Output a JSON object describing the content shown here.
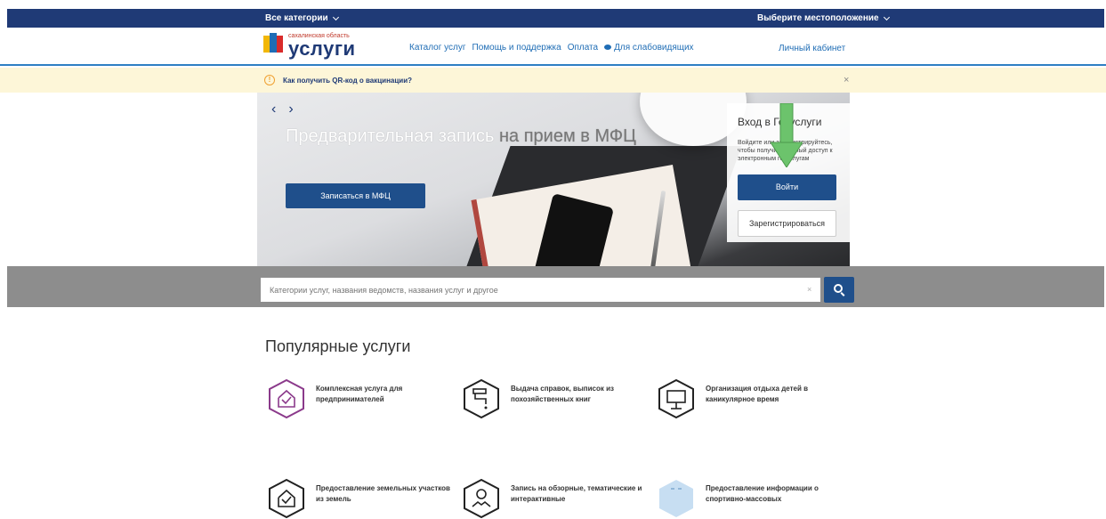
{
  "topbar": {
    "all_categories": "Все категории",
    "location": "Выберите местоположение"
  },
  "header": {
    "logo_small": "сахалинская область",
    "logo_big": "услуги",
    "nav": [
      "Каталог услуг",
      "Помощь и поддержка",
      "Оплата",
      "Для слабовидящих"
    ],
    "cabinet": "Личный кабинет"
  },
  "notice": {
    "message": "Как получить QR-код о вакцинации?",
    "close": "×"
  },
  "hero": {
    "title_white": "Предварительная запись",
    "title_dark": " на прием в МФЦ",
    "button": "Записаться в МФЦ"
  },
  "login": {
    "title": "Вход в Госуслуги",
    "description": "Войдите или зарегистрируйтесь, чтобы получить полный доступ к электронным госуслугам",
    "login_button": "Войти",
    "register_button": "Зарегистрироваться"
  },
  "search": {
    "placeholder": "Категории услуг, названия ведомств, названия услуг и другое",
    "clear": "×"
  },
  "popular": {
    "title": "Популярные услуги",
    "services": [
      {
        "label": "Комплексная услуга для предпринимателей",
        "icon": "house-check-icon"
      },
      {
        "label": "Выдача справок, выписок из похозяйственных книг",
        "icon": "faucet-icon"
      },
      {
        "label": "Организация отдыха детей в каникулярное время",
        "icon": "billboard-icon"
      },
      {
        "label": "Предоставление земельных участков из земель",
        "icon": "house-check-icon"
      },
      {
        "label": "Запись на обзорные, тематические и интерактивные",
        "icon": "map-pin-icon"
      },
      {
        "label": "Предоставление информации о спортивно-массовых",
        "icon": "sport-icon"
      }
    ]
  },
  "colors": {
    "brand_dark": "#1f3a76",
    "button_blue": "#1f4f8b",
    "link_blue": "#1f6db5",
    "notice_bg": "#fdf6d8",
    "accent_purple": "#8b3a8b"
  }
}
